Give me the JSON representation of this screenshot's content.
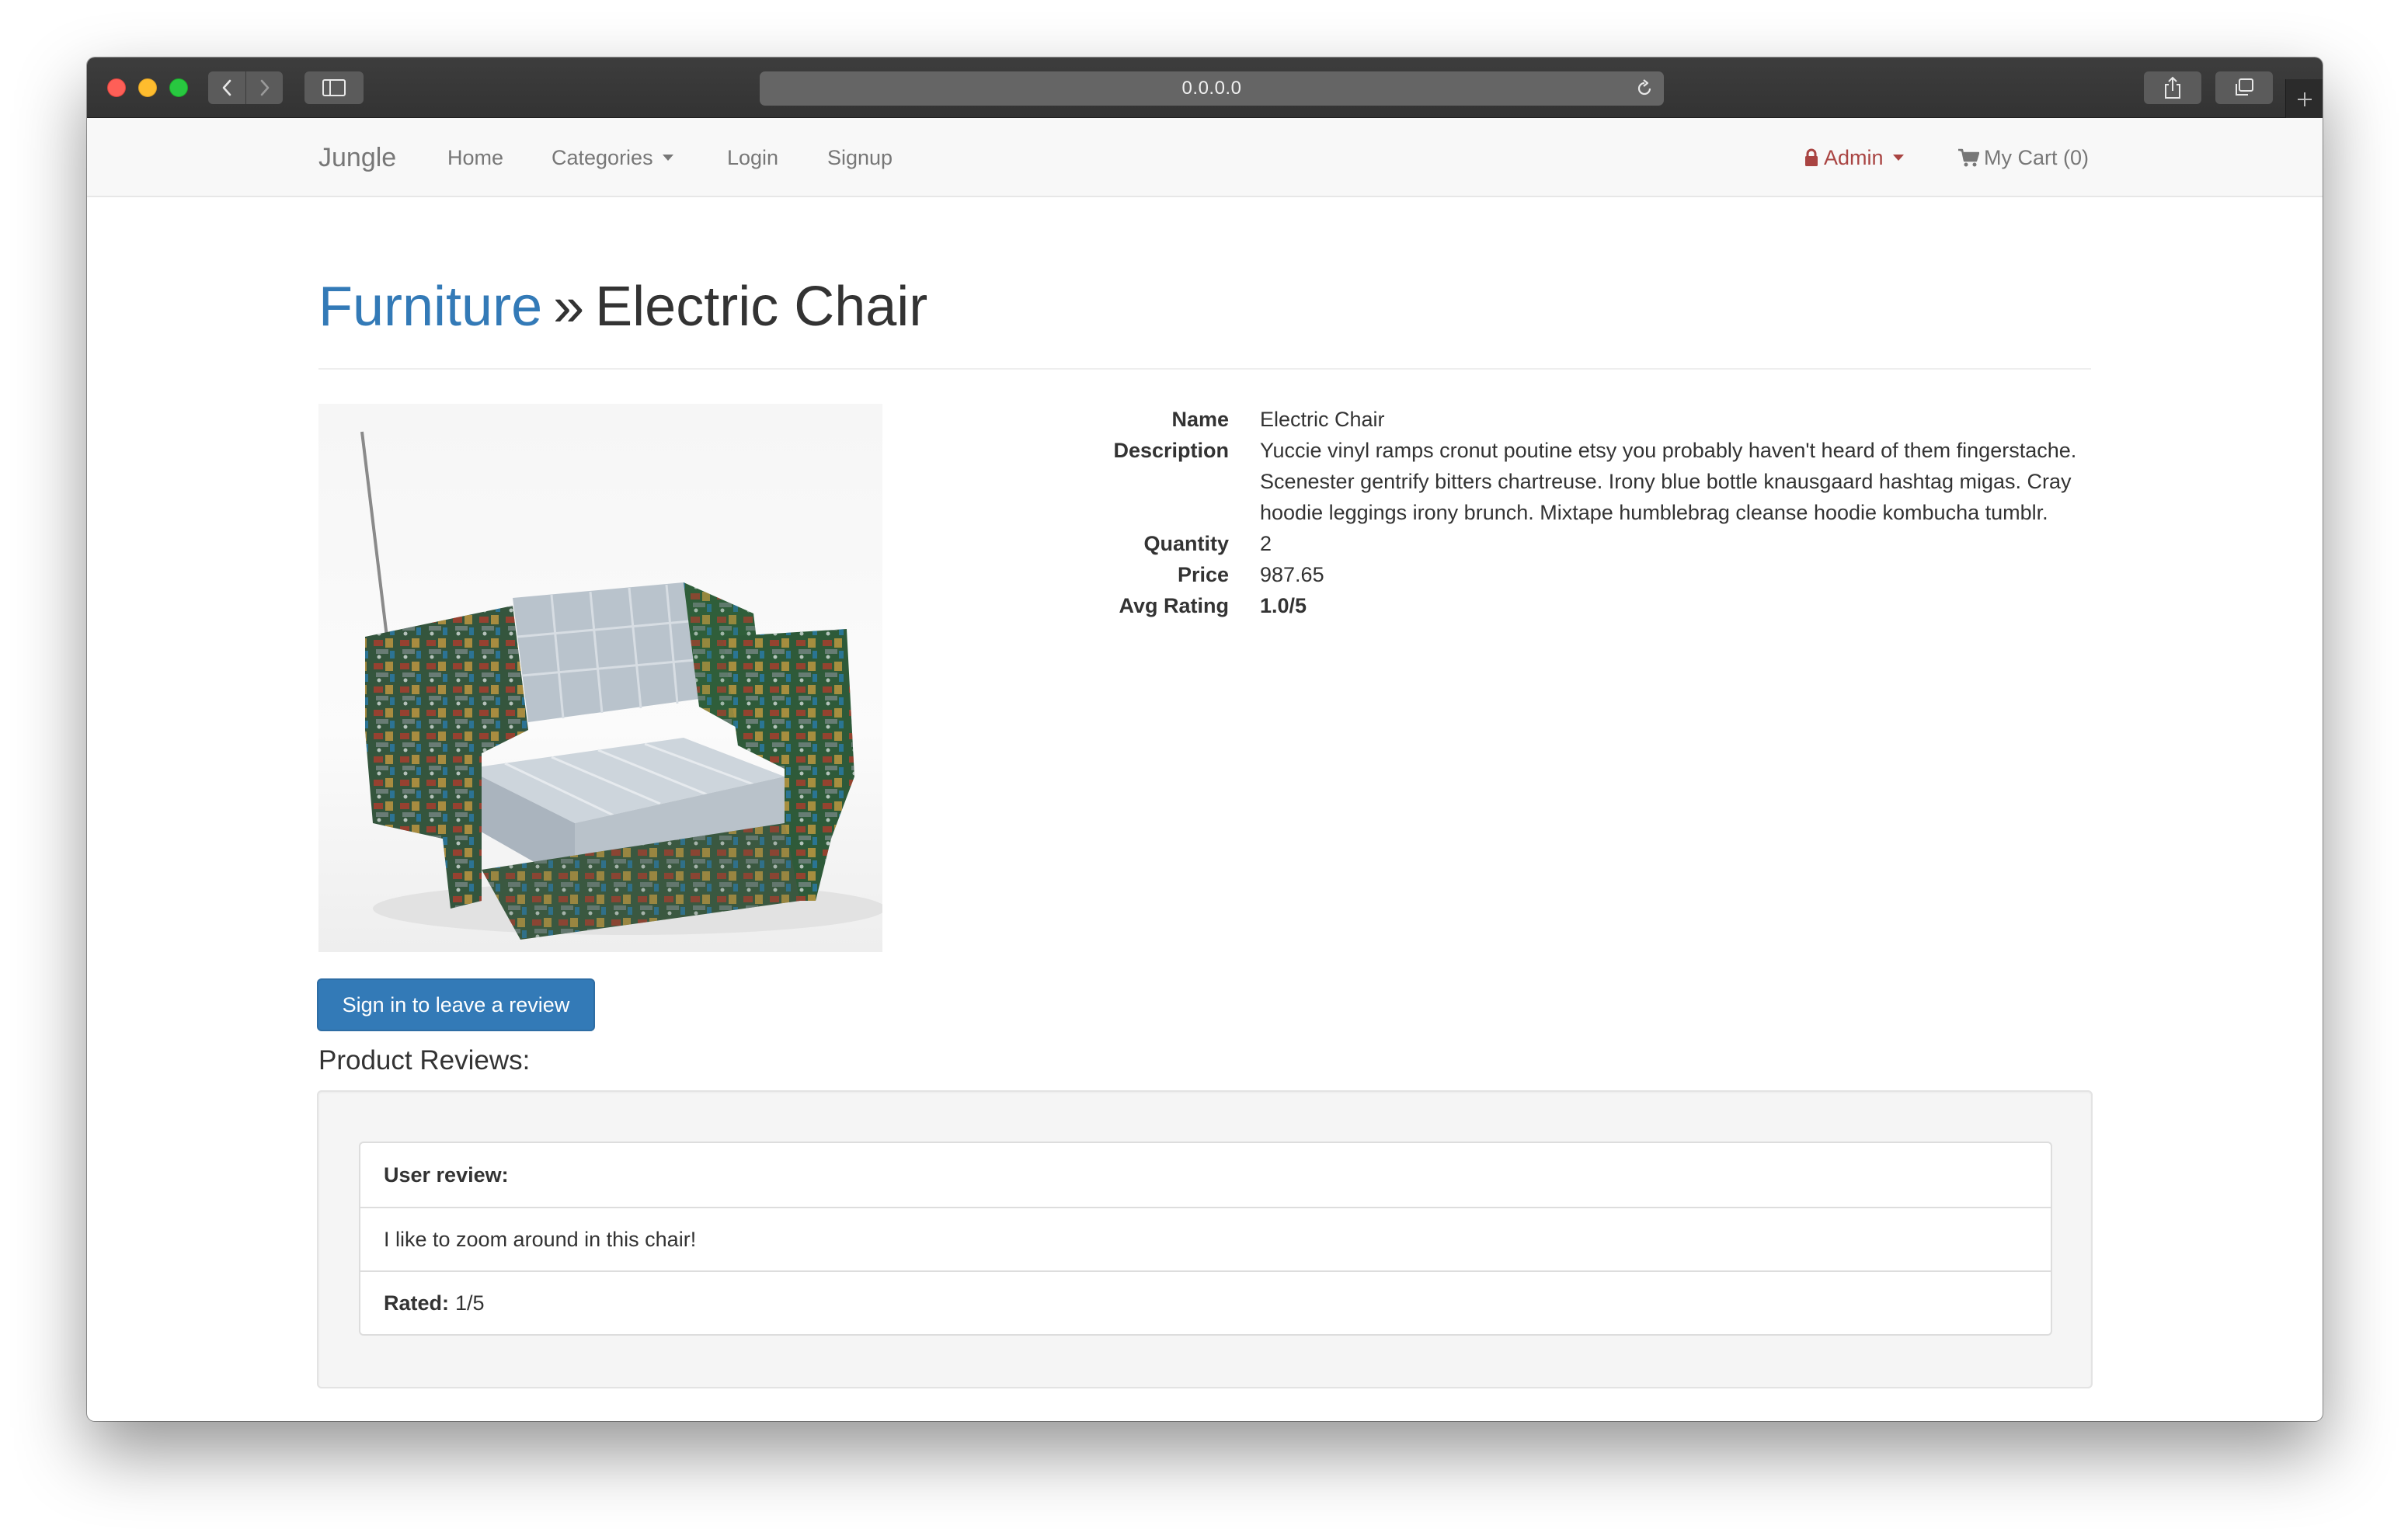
{
  "browser": {
    "url": "0.0.0.0"
  },
  "navbar": {
    "brand": "Jungle",
    "home": "Home",
    "categories": "Categories",
    "login": "Login",
    "signup": "Signup",
    "admin": "Admin",
    "cart": "My Cart (0)"
  },
  "header": {
    "category": "Furniture",
    "separator": "»",
    "product": "Electric Chair"
  },
  "details": {
    "name_label": "Name",
    "name": "Electric Chair",
    "description_label": "Description",
    "description": "Yuccie vinyl ramps cronut poutine etsy you probably haven't heard of them fingerstache. Scenester gentrify bitters chartreuse. Irony blue bottle knausgaard hashtag migas. Cray hoodie leggings irony brunch. Mixtape humblebrag cleanse hoodie kombucha tumblr.",
    "quantity_label": "Quantity",
    "quantity": "2",
    "price_label": "Price",
    "price": "987.65",
    "rating_label": "Avg Rating",
    "rating": "1.0/5"
  },
  "review_button": "Sign in to leave a review",
  "reviews": {
    "title": "Product Reviews:",
    "items": [
      {
        "header": "User review:",
        "body": "I like to zoom around in this chair!",
        "rated_label": "Rated:",
        "rated": "1/5"
      }
    ]
  },
  "colors": {
    "link": "#337ab7",
    "admin": "#a94442",
    "button": "#337ab7"
  }
}
